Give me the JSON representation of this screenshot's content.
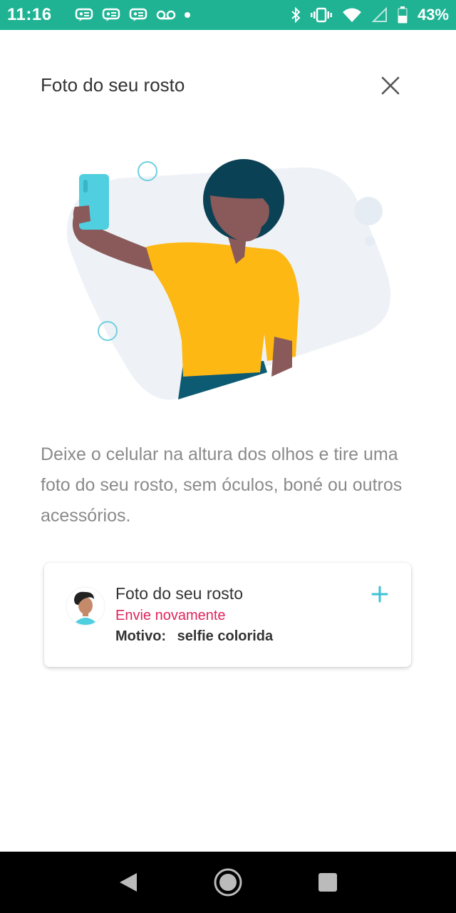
{
  "status_bar": {
    "time": "11:16",
    "battery": "43%",
    "notification_icons": [
      "message-icon",
      "message-icon",
      "message-icon",
      "voicemail-icon"
    ],
    "right_icons": [
      "bluetooth-icon",
      "vibrate-icon",
      "wifi-icon",
      "signal-icon",
      "battery-icon"
    ],
    "background_color": "#1fb394"
  },
  "header": {
    "title": "Foto do seu rosto",
    "close_icon": "close-icon"
  },
  "instructions": {
    "text": "Deixe o celular na altura dos olhos e tire uma foto do seu rosto, sem óculos, boné ou outros acessórios."
  },
  "card": {
    "title": "Foto do seu rosto",
    "status": "Envie novamente",
    "status_color": "#e0245e",
    "reason_label": "Motivo:",
    "reason_value": "selfie colorida",
    "add_icon": "plus-icon",
    "accent_color": "#3fc1d3"
  },
  "nav_bar": {
    "buttons": [
      "back-icon",
      "home-icon",
      "recents-icon"
    ]
  }
}
